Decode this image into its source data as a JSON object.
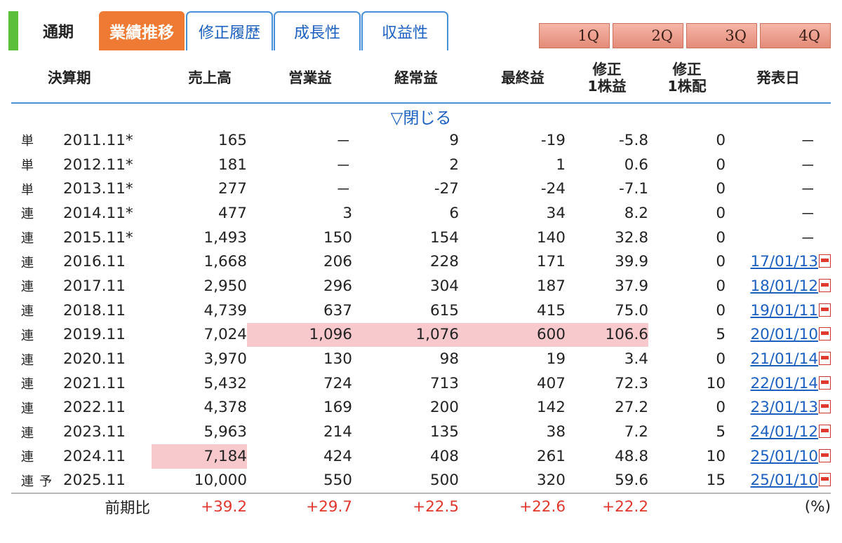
{
  "tabs": {
    "plain": "通期",
    "active": "業績推移",
    "links": [
      "修正履歴",
      "成長性",
      "収益性"
    ]
  },
  "quarters": [
    "1Q",
    "2Q",
    "3Q",
    "4Q"
  ],
  "columns": {
    "period": "決算期",
    "sales": "売上高",
    "operating": "営業益",
    "ordinary": "経常益",
    "net": "最終益",
    "eps_1": "修正",
    "eps_2": "1株益",
    "div_1": "修正",
    "div_2": "1株配",
    "date": "発表日"
  },
  "toggle_label": "▽閉じる",
  "rows": [
    {
      "type": "単",
      "forecast": "",
      "period": "2011.11*",
      "sales": "165",
      "operating": "－",
      "ordinary": "9",
      "net": "-19",
      "eps": "-5.8",
      "div": "0",
      "date": "－",
      "hl": []
    },
    {
      "type": "単",
      "forecast": "",
      "period": "2012.11*",
      "sales": "181",
      "operating": "－",
      "ordinary": "2",
      "net": "1",
      "eps": "0.6",
      "div": "0",
      "date": "－",
      "hl": []
    },
    {
      "type": "単",
      "forecast": "",
      "period": "2013.11*",
      "sales": "277",
      "operating": "－",
      "ordinary": "-27",
      "net": "-24",
      "eps": "-7.1",
      "div": "0",
      "date": "－",
      "hl": []
    },
    {
      "type": "連",
      "forecast": "",
      "period": "2014.11*",
      "sales": "477",
      "operating": "3",
      "ordinary": "6",
      "net": "34",
      "eps": "8.2",
      "div": "0",
      "date": "－",
      "hl": []
    },
    {
      "type": "連",
      "forecast": "",
      "period": "2015.11*",
      "sales": "1,493",
      "operating": "150",
      "ordinary": "154",
      "net": "140",
      "eps": "32.8",
      "div": "0",
      "date": "－",
      "hl": []
    },
    {
      "type": "連",
      "forecast": "",
      "period": "2016.11",
      "sales": "1,668",
      "operating": "206",
      "ordinary": "228",
      "net": "171",
      "eps": "39.9",
      "div": "0",
      "date": "17/01/13",
      "hl": []
    },
    {
      "type": "連",
      "forecast": "",
      "period": "2017.11",
      "sales": "2,950",
      "operating": "296",
      "ordinary": "304",
      "net": "187",
      "eps": "37.9",
      "div": "0",
      "date": "18/01/12",
      "hl": []
    },
    {
      "type": "連",
      "forecast": "",
      "period": "2018.11",
      "sales": "4,739",
      "operating": "637",
      "ordinary": "615",
      "net": "415",
      "eps": "75.0",
      "div": "0",
      "date": "19/01/11",
      "hl": []
    },
    {
      "type": "連",
      "forecast": "",
      "period": "2019.11",
      "sales": "7,024",
      "operating": "1,096",
      "ordinary": "1,076",
      "net": "600",
      "eps": "106.6",
      "div": "5",
      "date": "20/01/10",
      "hl": [
        "operating",
        "ordinary",
        "net",
        "eps"
      ]
    },
    {
      "type": "連",
      "forecast": "",
      "period": "2020.11",
      "sales": "3,970",
      "operating": "130",
      "ordinary": "98",
      "net": "19",
      "eps": "3.4",
      "div": "0",
      "date": "21/01/14",
      "hl": []
    },
    {
      "type": "連",
      "forecast": "",
      "period": "2021.11",
      "sales": "5,432",
      "operating": "724",
      "ordinary": "713",
      "net": "407",
      "eps": "72.3",
      "div": "10",
      "date": "22/01/14",
      "hl": []
    },
    {
      "type": "連",
      "forecast": "",
      "period": "2022.11",
      "sales": "4,378",
      "operating": "169",
      "ordinary": "200",
      "net": "142",
      "eps": "27.2",
      "div": "0",
      "date": "23/01/13",
      "hl": []
    },
    {
      "type": "連",
      "forecast": "",
      "period": "2023.11",
      "sales": "5,963",
      "operating": "214",
      "ordinary": "135",
      "net": "38",
      "eps": "7.2",
      "div": "5",
      "date": "24/01/12",
      "hl": []
    },
    {
      "type": "連",
      "forecast": "",
      "period": "2024.11",
      "sales": "7,184",
      "operating": "424",
      "ordinary": "408",
      "net": "261",
      "eps": "48.8",
      "div": "10",
      "date": "25/01/10",
      "hl": [
        "sales"
      ]
    },
    {
      "type": "連",
      "forecast": "予",
      "period": "2025.11",
      "sales": "10,000",
      "operating": "550",
      "ordinary": "500",
      "net": "320",
      "eps": "59.6",
      "div": "15",
      "date": "25/01/10",
      "hl": []
    }
  ],
  "summary": {
    "label": "前期比",
    "sales": "+39.2",
    "operating": "+29.7",
    "ordinary": "+22.5",
    "net": "+22.6",
    "eps": "+22.2",
    "unit": "(%)"
  },
  "colors": {
    "accent_orange": "#ef7a33",
    "link_blue": "#1b5fc1",
    "highlight_pink": "#f7c9cd",
    "positive_red": "#e0362c",
    "marker_green": "#5bbf3a"
  }
}
